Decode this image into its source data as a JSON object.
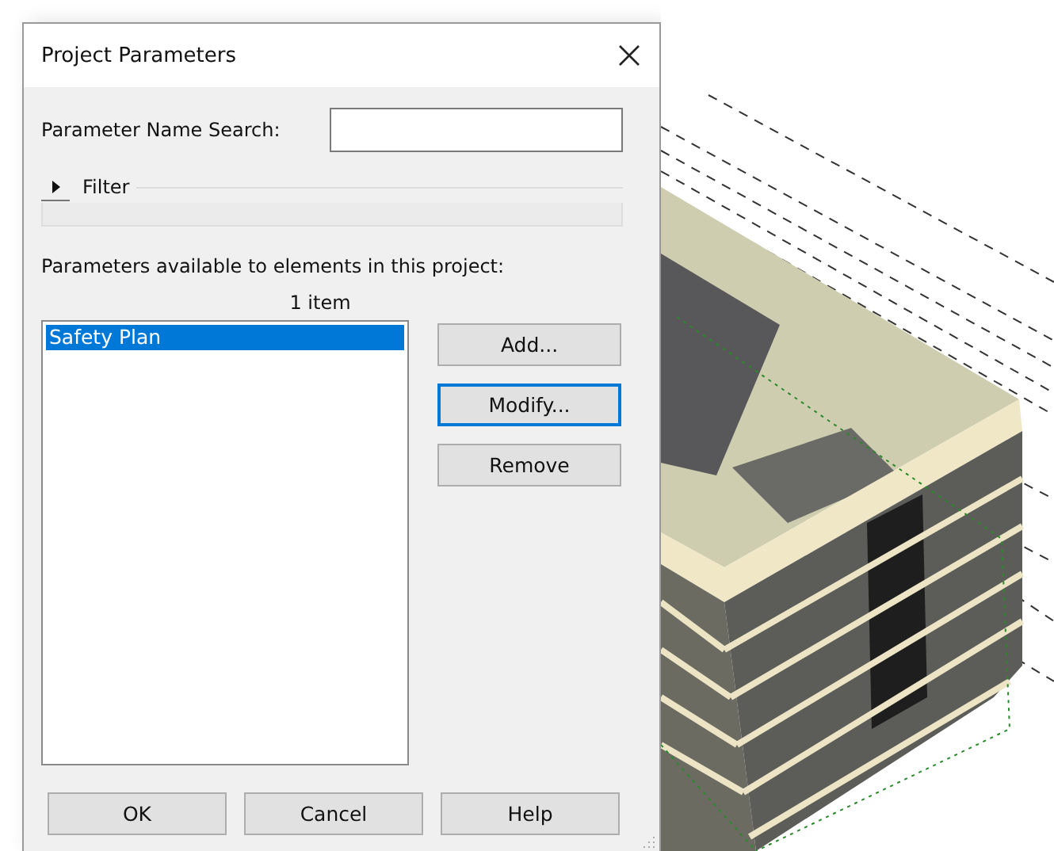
{
  "window": {
    "title": "Project Parameters"
  },
  "search": {
    "label": "Parameter Name Search:"
  },
  "filter": {
    "label": "Filter",
    "expanded": false
  },
  "list": {
    "caption": "Parameters available to elements in this project:",
    "count": "1 item",
    "items": [
      {
        "label": "Safety Plan",
        "selected": true
      }
    ]
  },
  "side_buttons": [
    {
      "label": "Add...",
      "focused": false
    },
    {
      "label": "Modify...",
      "focused": true
    },
    {
      "label": "Remove",
      "focused": false
    }
  ],
  "buttons": [
    "OK",
    "Cancel",
    "Help"
  ]
}
